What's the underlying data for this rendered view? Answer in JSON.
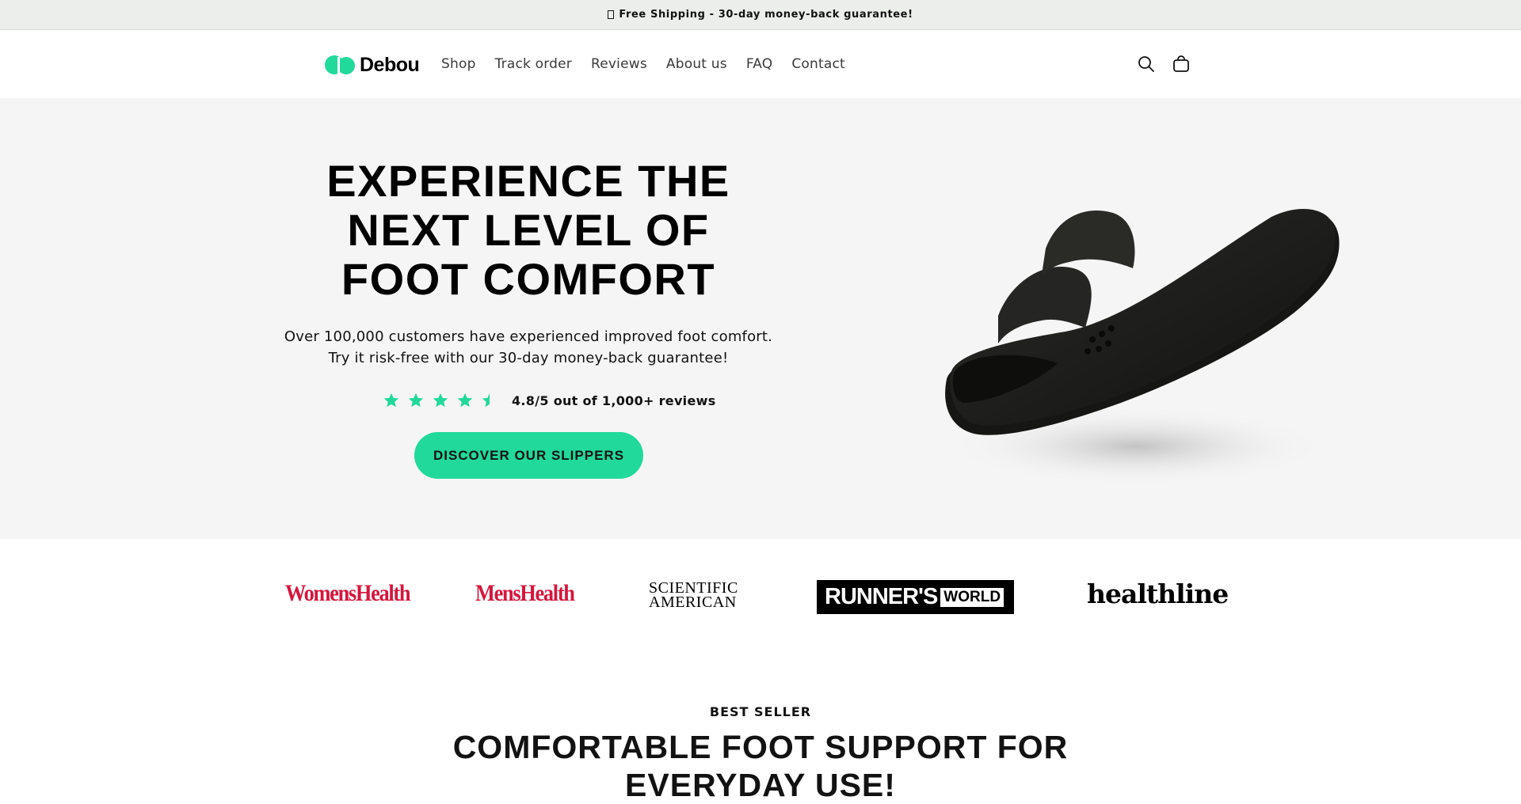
{
  "announcement": {
    "text": "Free Shipping - 30-day money-back guarantee!"
  },
  "header": {
    "logo_text": "Debou",
    "nav": [
      "Shop",
      "Track order",
      "Reviews",
      "About us",
      "FAQ",
      "Contact"
    ],
    "icons": [
      "search-icon",
      "cart-icon"
    ]
  },
  "hero": {
    "title_lines": [
      "EXPERIENCE THE",
      "NEXT LEVEL OF",
      "FOOT COMFORT"
    ],
    "subtitle_lines": [
      "Over 100,000 customers have experienced improved foot comfort.",
      "Try it risk-free with our 30-day money-back guarantee!"
    ],
    "rating": {
      "stars": 4.5,
      "text": "4.8/5 out of 1,000+ reviews"
    },
    "cta_label": "DISCOVER OUR SLIPPERS"
  },
  "press_logos": {
    "womens_health": "WomensHealth",
    "mens_health": "MensHealth",
    "scientific_american": [
      "SCIENTIFIC",
      "AMERICAN"
    ],
    "runners_world": [
      "RUNNER'S",
      "WORLD"
    ],
    "healthline": "healthline"
  },
  "bestseller": {
    "eyebrow": "BEST SELLER",
    "title_lines": [
      "COMFORTABLE FOOT SUPPORT FOR",
      "EVERYDAY USE!"
    ]
  },
  "colors": {
    "accent": "#21d99b",
    "press_red": "#d6163d",
    "hero_bg": "#f5f5f5"
  }
}
